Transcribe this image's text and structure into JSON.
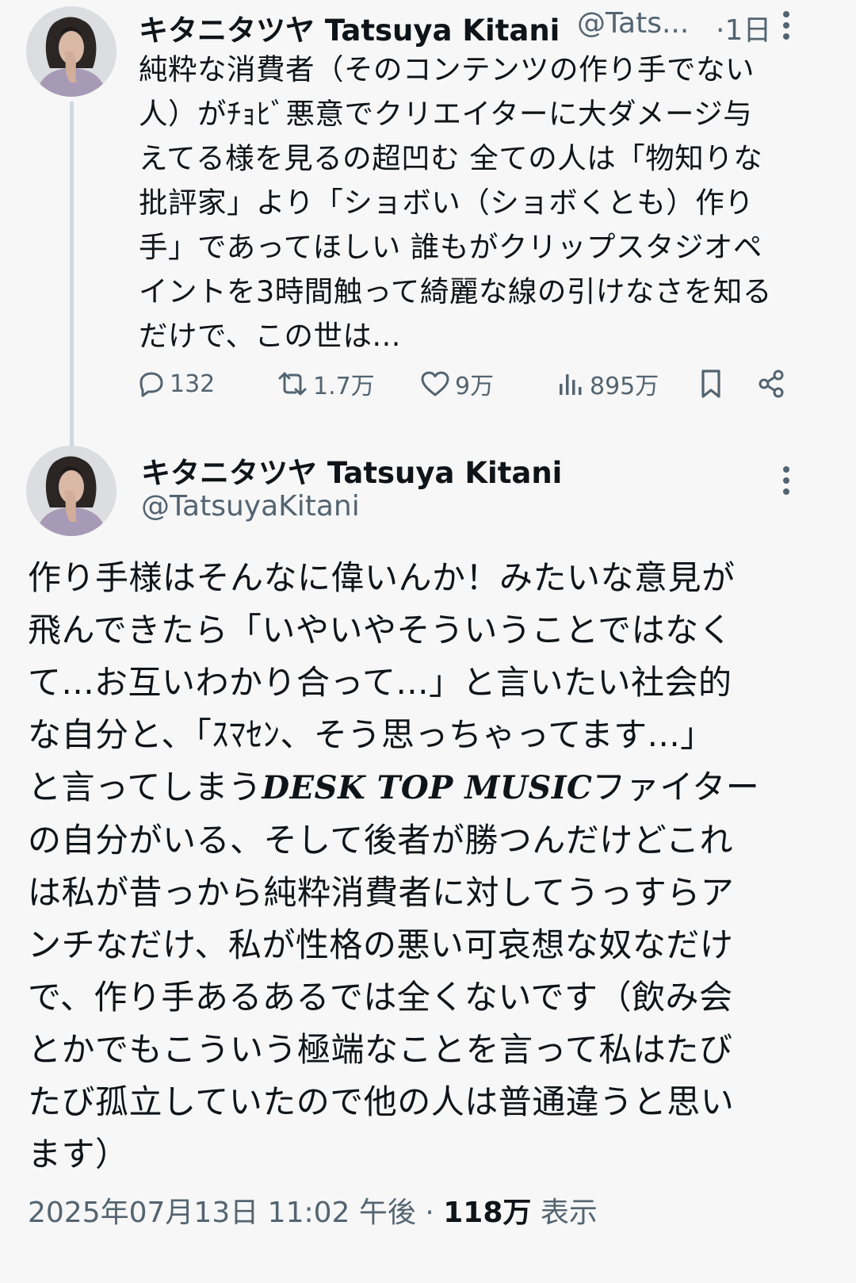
{
  "colors": {
    "text_primary": "#0f1419",
    "text_secondary": "#536471",
    "thread_line": "#cfd9de",
    "background": "#f7f7f7"
  },
  "tweet1": {
    "display_name": "キタニタツヤ Tatsuya Kitani",
    "handle": "@Tats...",
    "separator": "·",
    "time": "1日",
    "body": "純粋な消費者（そのコンテンツの作り手でない\n人）がﾁｮﾋﾞ悪意でクリエイターに大ダメージ与\nえてる様を見るの超凹む 全ての人は「物知りな\n批評家」より「ショボい（ショボくとも）作り\n手」であってほしい 誰もがクリップスタジオペ\nイントを3時間触って綺麗な線の引けなさを知る\nだけで、この世は...",
    "actions": {
      "reply": {
        "icon": "reply-icon",
        "count": "132"
      },
      "retweet": {
        "icon": "retweet-icon",
        "count": "1.7万"
      },
      "like": {
        "icon": "heart-icon",
        "count": "9万"
      },
      "views": {
        "icon": "views-icon",
        "count": "895万"
      },
      "bookmark": {
        "icon": "bookmark-icon"
      },
      "share": {
        "icon": "share-icon"
      }
    }
  },
  "tweet2": {
    "display_name": "キタニタツヤ Tatsuya Kitani",
    "handle": "@TatsuyaKitani",
    "body_part1": "作り手様はそんなに偉いんか！みたいな意見が\n飛んできたら「いやいやそういうことではなく\nて...お互いわかり合って...」と言いたい社会的\nな自分と、「ｽﾏｾﾝ、そう思っちゃってます...」\nと言ってしまう",
    "body_emphasis": "DESK TOP MUSIC",
    "body_part2": "ファイター\nの自分がいる、そして後者が勝つんだけどこれ\nは私が昔っから純粋消費者に対してうっすらア\nンチなだけ、私が性格の悪い可哀想な奴なだけ\nで、作り手あるあるでは全くないです（飲み会\nとかでもこういう極端なことを言って私はたび\nたび孤立していたので他の人は普通違うと思い\nます）",
    "date": "2025年07月13日 11:02 午後",
    "separator": " · ",
    "views_count": "118万",
    "views_label": " 表示"
  }
}
